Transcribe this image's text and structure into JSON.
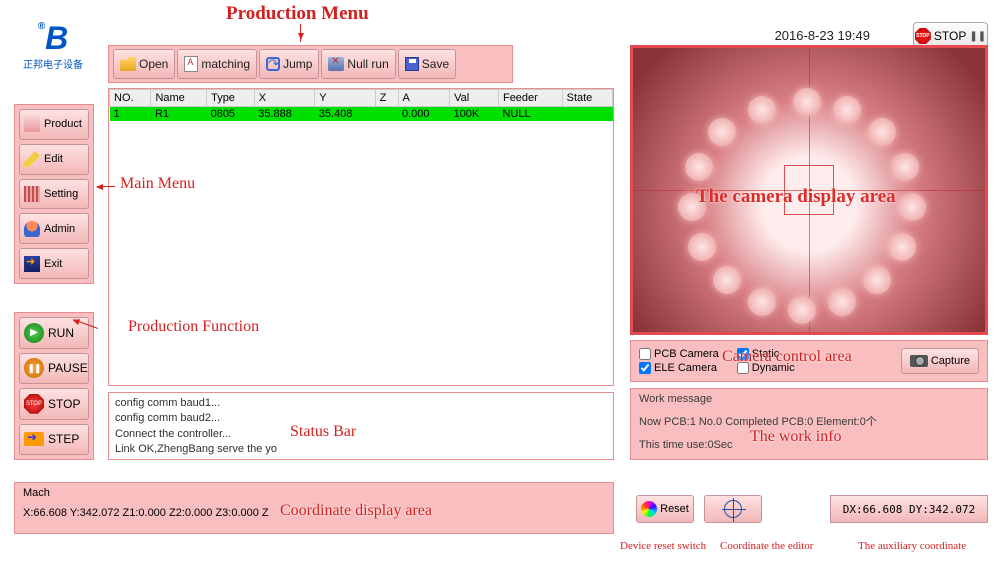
{
  "logo": {
    "brand": "B",
    "subtitle": "正邦电子设备"
  },
  "timestamp": "2016-8-23 19:49",
  "top_stop": {
    "icon": "STOP",
    "label": "STOP",
    "bars": "❚❚"
  },
  "prod_menu": {
    "open": "Open",
    "matching": "matching",
    "jump": "Jump",
    "nullrun": "Null run",
    "save": "Save"
  },
  "main_menu": {
    "product": "Product",
    "edit": "Edit",
    "setting": "Setting",
    "admin": "Admin",
    "exit": "Exit"
  },
  "run_ctrl": {
    "run": "RUN",
    "pause": "PAUSE",
    "stop": "STOP",
    "step": "STEP"
  },
  "table": {
    "headers": [
      "NO.",
      "Name",
      "Type",
      "X",
      "Y",
      "Z",
      "A",
      "Val",
      "Feeder",
      "State"
    ],
    "row": {
      "no": "1",
      "name": "R1",
      "type": "0805",
      "x": "35.888",
      "y": "35.408",
      "z": "",
      "a": "0.000",
      "val": "100K",
      "feeder": "NULL",
      "state": ""
    }
  },
  "status_lines": {
    "l1": "config comm baud1...",
    "l2": "config comm baud2...",
    "l3": "Connect the controller...",
    "l4": "Link OK,ZhengBang serve the yo"
  },
  "cam_ctrl": {
    "pcb": "PCB Camera",
    "ele": "ELE Camera",
    "static": "Static",
    "dynamic": "Dynamic",
    "capture": "Capture"
  },
  "work": {
    "title": "Work message",
    "line1": "Now PCB:1 No.0 Completed PCB:0 Element:0个",
    "line2": "This time use:0Sec"
  },
  "mach": {
    "title": "Mach",
    "coords": "X:66.608 Y:342.072 Z1:0.000 Z2:0.000 Z3:0.000 Z"
  },
  "reset_btn": "Reset",
  "aux_coord": "DX:66.608 DY:342.072",
  "annotations": {
    "prod_menu": "Production Menu",
    "main_menu": "Main Menu",
    "prod_func": "Production Function",
    "status_bar": "Status Bar",
    "coord_area": "Coordinate display area",
    "camera": "The camera display area",
    "cam_ctrl": "Camera control area",
    "work_info": "The work info",
    "reset": "Device reset switch",
    "coord_edit": "Coordinate the editor",
    "aux": "The auxiliary coordinate"
  }
}
